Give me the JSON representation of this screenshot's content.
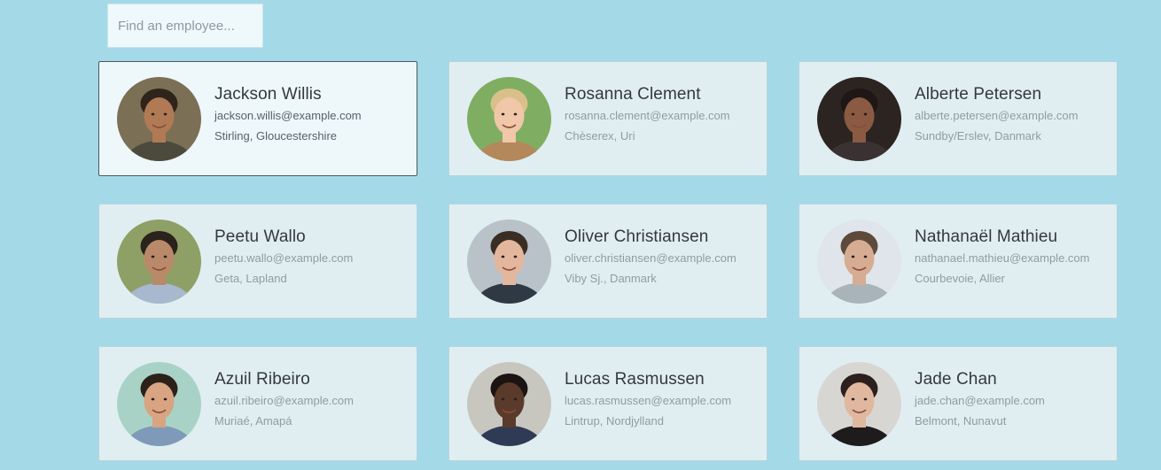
{
  "search": {
    "placeholder": "Find an employee..."
  },
  "employees": [
    {
      "name": "Jackson Willis",
      "email": "jackson.willis@example.com",
      "location": "Stirling, Gloucestershire",
      "selected": true,
      "avatar": {
        "bg": "#7b6f55",
        "skin": "#b07a55",
        "hair": "#2f241b",
        "shirt": "#4c4a3d"
      }
    },
    {
      "name": "Rosanna Clement",
      "email": "rosanna.clement@example.com",
      "location": "Chèserex, Uri",
      "selected": false,
      "avatar": {
        "bg": "#7fae62",
        "skin": "#f0c7a8",
        "hair": "#d9c08a",
        "shirt": "#b4885a"
      }
    },
    {
      "name": "Alberte Petersen",
      "email": "alberte.petersen@example.com",
      "location": "Sundby/Erslev, Danmark",
      "selected": false,
      "avatar": {
        "bg": "#2c2421",
        "skin": "#8a5a42",
        "hair": "#1e1716",
        "shirt": "#3a3133"
      }
    },
    {
      "name": "Peetu Wallo",
      "email": "peetu.wallo@example.com",
      "location": "Geta, Lapland",
      "selected": false,
      "avatar": {
        "bg": "#8ea065",
        "skin": "#b98a6a",
        "hair": "#2a221c",
        "shirt": "#a8b8cf"
      }
    },
    {
      "name": "Oliver Christiansen",
      "email": "oliver.christiansen@example.com",
      "location": "Viby Sj., Danmark",
      "selected": false,
      "avatar": {
        "bg": "#b9c2c9",
        "skin": "#e2b79e",
        "hair": "#3a2d24",
        "shirt": "#2e3944"
      }
    },
    {
      "name": "Nathanaël Mathieu",
      "email": "nathanael.mathieu@example.com",
      "location": "Courbevoie, Allier",
      "selected": false,
      "avatar": {
        "bg": "#dfe5ea",
        "skin": "#d6ad93",
        "hair": "#5e4a3b",
        "shirt": "#a9b3ba"
      }
    },
    {
      "name": "Azuil Ribeiro",
      "email": "azuil.ribeiro@example.com",
      "location": "Muriaé, Amapá",
      "selected": false,
      "avatar": {
        "bg": "#a9d2c6",
        "skin": "#d8a482",
        "hair": "#2b2119",
        "shirt": "#7f9ab8"
      }
    },
    {
      "name": "Lucas Rasmussen",
      "email": "lucas.rasmussen@example.com",
      "location": "Lintrup, Nordjylland",
      "selected": false,
      "avatar": {
        "bg": "#c7c7c0",
        "skin": "#5a3a2b",
        "hair": "#1c1412",
        "shirt": "#2f3a55"
      }
    },
    {
      "name": "Jade Chan",
      "email": "jade.chan@example.com",
      "location": "Belmont, Nunavut",
      "selected": false,
      "avatar": {
        "bg": "#d8d6d3",
        "skin": "#e0b8a0",
        "hair": "#2b201d",
        "shirt": "#1d1b1c"
      }
    }
  ]
}
